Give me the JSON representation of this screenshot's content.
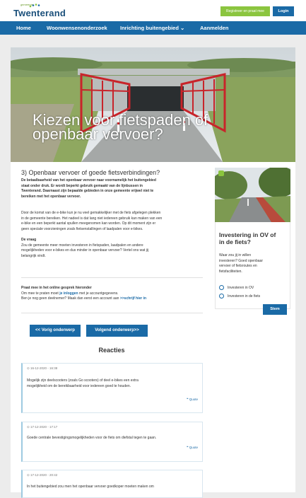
{
  "header": {
    "logo_small": "gemeente",
    "logo_name": "Twenterand",
    "register_label": "Registreer en praat mee",
    "login_label": "Login"
  },
  "nav": {
    "items": [
      "Home",
      "Woonwensenonderzoek",
      "Inrichting buitengebied ⌄",
      "Aanmelden"
    ]
  },
  "hero": {
    "title_line1": "Kiezen voor fietspaden of",
    "title_line2": "openbaar vervoer?"
  },
  "article": {
    "title": "3) Openbaar vervoer of goede fietsverbindingen?",
    "intro_l1": "De betaalbaarheid van het openbaar vervoer naar voornamelijk het buitengebied",
    "intro_l2": "staat onder druk. Er wordt beperkt gebruik gemaakt van de lijnbussen in",
    "intro_l3": "Twenterand. Daarnaast zijn bepaalde gebieden in onze gemeente vrijwel niet te",
    "intro_l4": "bereiken met het openbaar vervoer.",
    "p2_l1": "Door de komst van de e-bike kun je nu veel gemakkelijker met de fiets afgelegen plekken",
    "p2_l2": "in de gemeente bereiken. Het nadeel is dat lang niet iedereen gebruik kan maken van een",
    "p2_l3": "e-bike en een beperkt aantal spullen meegenomen kan worden. Op dit moment zijn er",
    "p2_l4": "geen speciale voorzieningen zoals fietsenstallingen of laadpalen voor e-bikes.",
    "vraag_heading": "De vraag",
    "vraag_l1": "Zou de gemeente meer moeten investeren in fietspaden, laadpalen en andere",
    "vraag_l2": "mogelijkheden voor e-bikes en dus minder in openbaar vervoer? Vertel ons wat jij",
    "vraag_l3": "belangrijk vindt.",
    "praat_heading": "Praat mee  in het online gesprek hieronder",
    "praat_l1_pre": "Om mee te praten moet ",
    "praat_l1_link": "je inloggen",
    "praat_l1_post": " met je accountgegevens.",
    "praat_l2_pre": "Ben je nog geen deelnemer? Maak dan eerst een account aan ",
    "praat_l2_link": ">>schrijf hier in",
    "prev_label": "<< Vorig onderwerp",
    "next_label": "Volgend onderwerp>>"
  },
  "comments": {
    "heading": "Reacties",
    "quote_label": "Quote",
    "items": [
      {
        "time": "16-12-2020 - 16:38",
        "l1": "Mogelijk zijn deelscooters (zoals Go scooters) of deel e-bikes een extra",
        "l2": "mogelijkheid om de bereikbaarheid voor iedereen goed te houden."
      },
      {
        "time": "17-12-2020 - 17:17",
        "l1": "Goede centrale bevestigingsmogelijkheden voor de fiets om diefstal tegen te gaan.",
        "l2": ""
      },
      {
        "time": "17-12-2020 - 20:42",
        "l1": "In het buitengebied zou men het openbaar vervoer goedkoper moeten maken om",
        "l2": ""
      }
    ]
  },
  "poll": {
    "title_l1": "Investering in OV of",
    "title_l2": "in de fiets?",
    "q_l1": "Waar zou jij in willen",
    "q_l2": "investeren? Goed openbaar",
    "q_l3": "vervoer of fietsroutes en",
    "q_l4": "fietsfaciliteiten.",
    "option1": "Investeren in OV",
    "option2": "Investeren in de fiets",
    "vote_label": "Stem"
  },
  "colors": {
    "primary": "#1a6aa6",
    "accent": "#8bc53f"
  }
}
